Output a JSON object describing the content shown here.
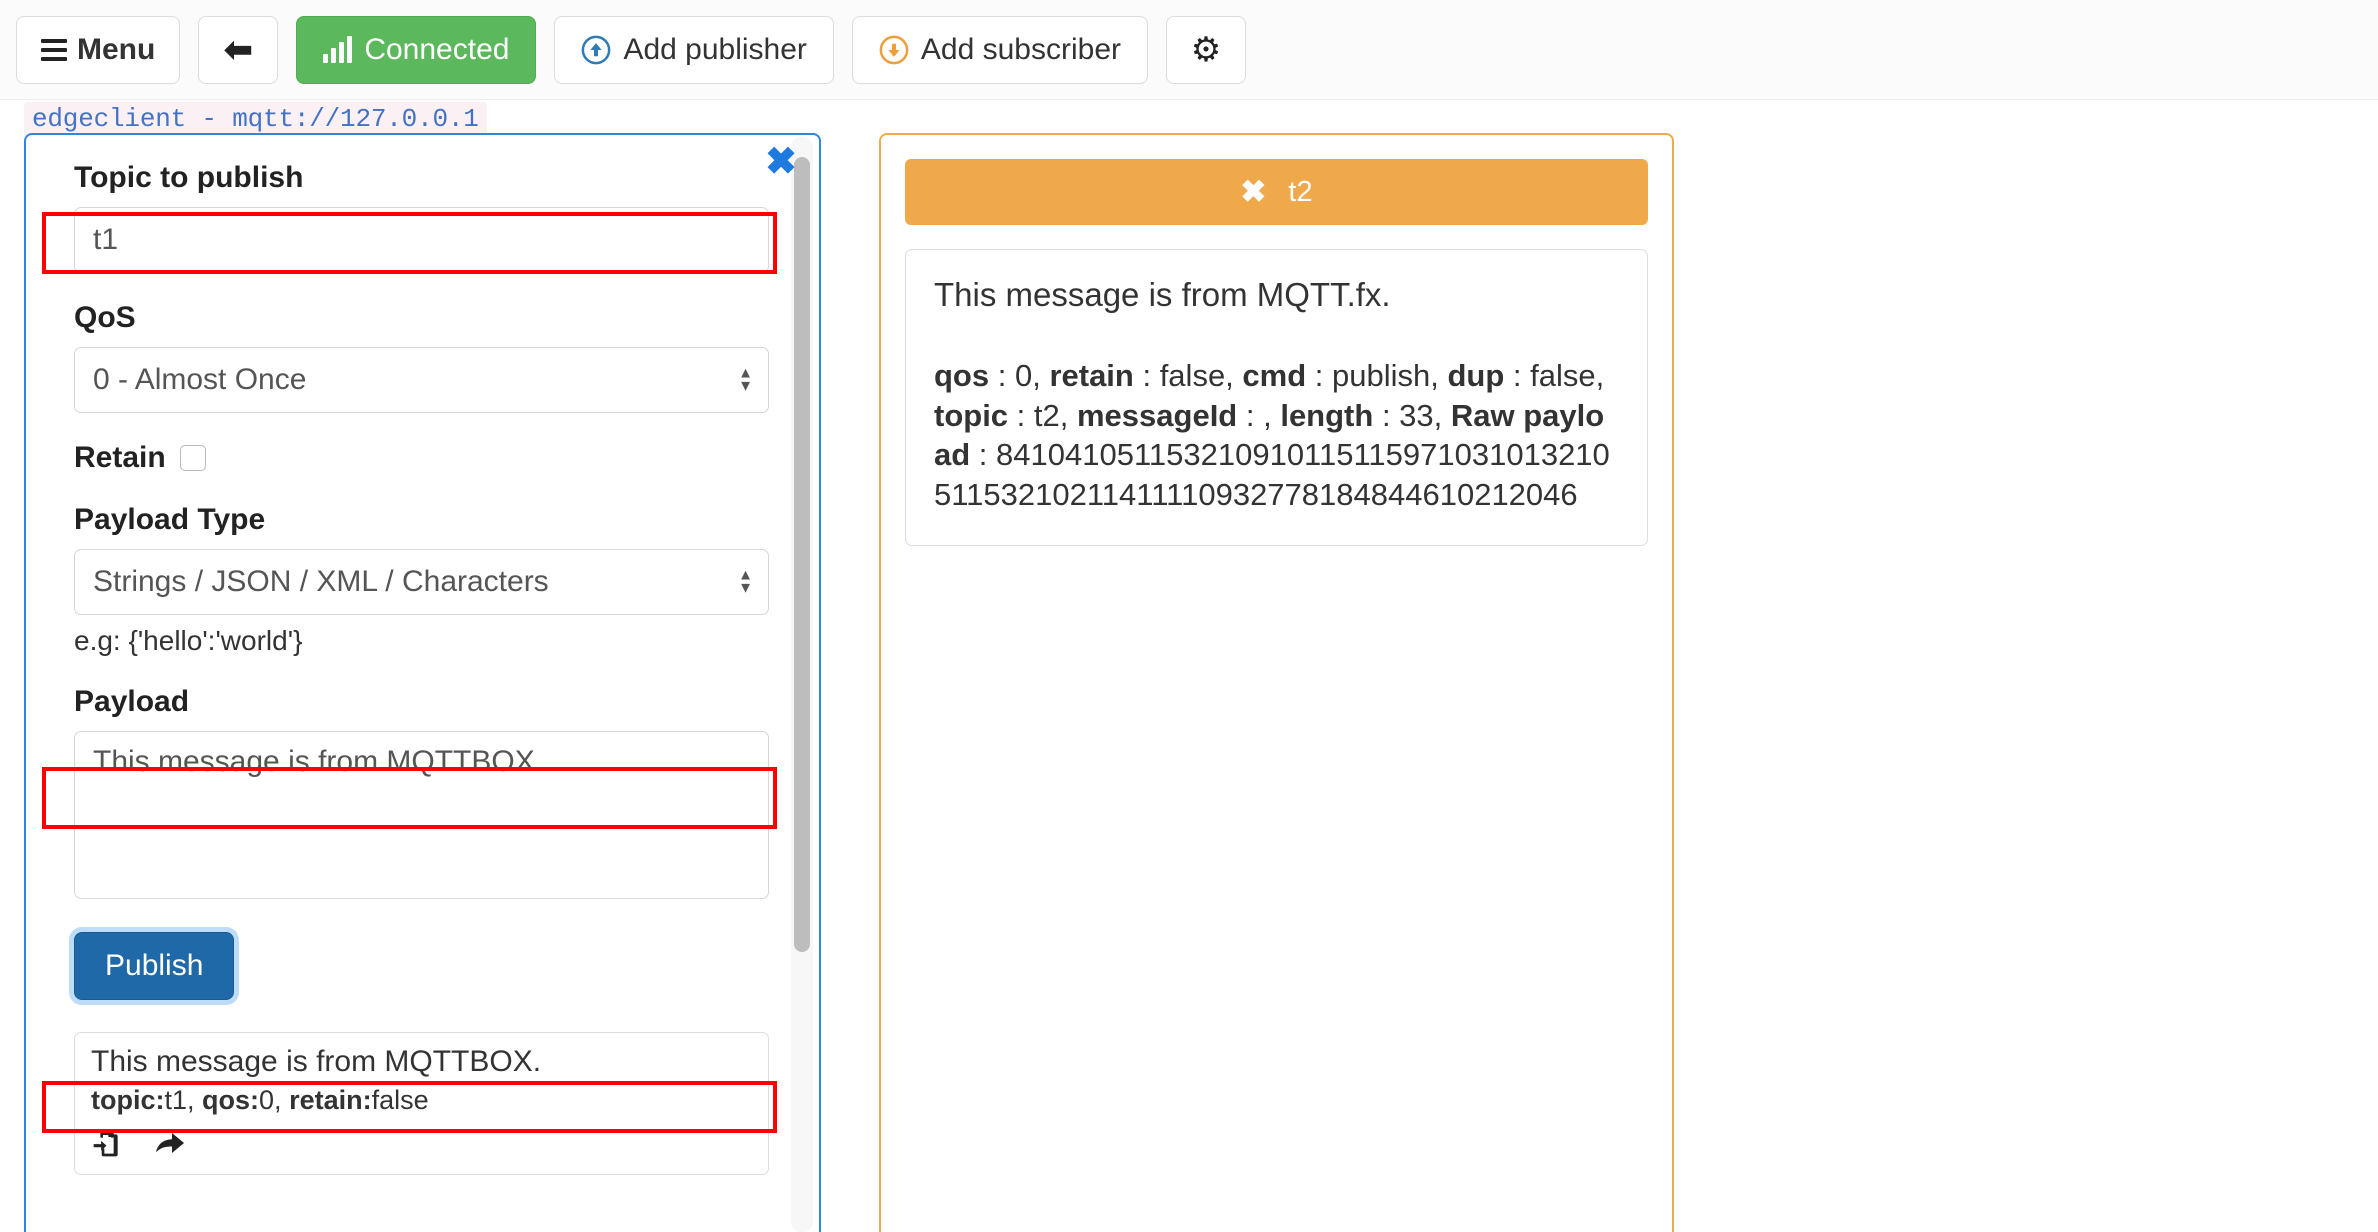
{
  "toolbar": {
    "menu_label": "Menu",
    "menu_icon": "hamburger-icon",
    "back_icon": "arrow-left-icon",
    "connected_label": "Connected",
    "connected_icon": "signal-bars-icon",
    "connected_color": "#5cb85c",
    "add_publisher_label": "Add publisher",
    "add_publisher_icon": "circle-arrow-up-icon",
    "add_publisher_color": "#2e7cb8",
    "add_subscriber_label": "Add subscriber",
    "add_subscriber_icon": "circle-arrow-down-icon",
    "add_subscriber_color": "#ef9f3a",
    "settings_icon": "gear-icon"
  },
  "client": {
    "label": "edgeclient - mqtt://127.0.0.1",
    "text_color": "#4472c4"
  },
  "publisher": {
    "border_color": "#2e86de",
    "close_icon": "close-x-icon",
    "topic_label": "Topic to publish",
    "topic_value": "t1",
    "qos_label": "QoS",
    "qos_value": "0 - Almost Once",
    "retain_label": "Retain",
    "retain_checked": false,
    "payload_type_label": "Payload Type",
    "payload_type_value": "Strings / JSON / XML / Characters",
    "payload_type_hint": "e.g: {'hello':'world'}",
    "payload_label": "Payload",
    "payload_value": "This message is from MQTTBOX.",
    "publish_button": "Publish",
    "history": {
      "message": "This message is from MQTTBOX.",
      "meta_topic_key": "topic:",
      "meta_topic_val": "t1, ",
      "meta_qos_key": "qos:",
      "meta_qos_val": "0, ",
      "meta_retain_key": "retain:",
      "meta_retain_val": "false",
      "copy_icon": "paste-clipboard-icon",
      "forward_icon": "share-arrow-icon"
    }
  },
  "subscriber": {
    "border_color": "#eeab4c",
    "header_color": "#efa94b",
    "header_close_icon": "close-x-icon",
    "topic": "t2",
    "message": "This message is from MQTT.fx.",
    "meta": {
      "qos_key": "qos",
      "qos_val": " : 0, ",
      "retain_key": "retain",
      "retain_val": " : false, ",
      "cmd_key": "cmd",
      "cmd_val": " : publish, ",
      "dup_key": "dup",
      "dup_val": " : false, ",
      "topic_key": "topic",
      "topic_val": " : t2, ",
      "messageid_key": "messageId",
      "messageid_val": " : , ",
      "length_key": "length",
      "length_val": " : 33, ",
      "rawpayload_key": "Raw payload",
      "rawpayload_val": " : 84104105115321091011511597103101321051153210211411110932778184844610212046"
    }
  },
  "annotations": {
    "highlight_color": "#ff0000",
    "boxes": [
      "topic-input",
      "payload-textarea",
      "history-message"
    ]
  }
}
